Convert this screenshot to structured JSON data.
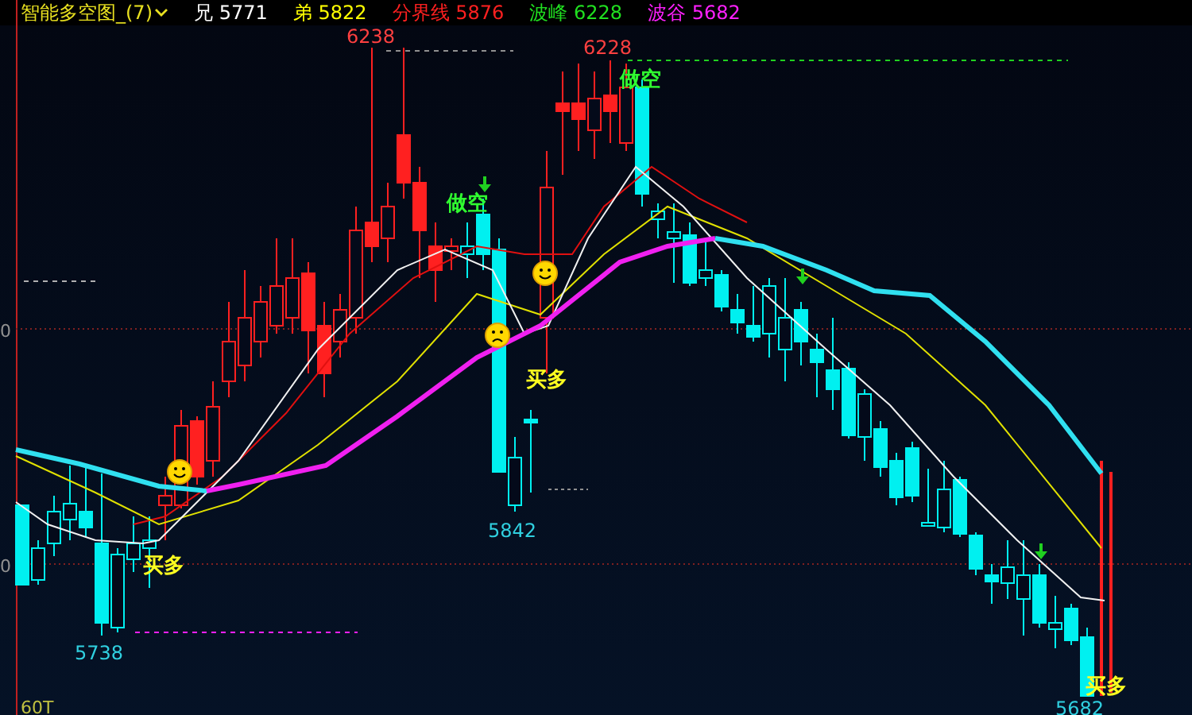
{
  "header": {
    "title": "智能多空图_(7)",
    "legend": [
      {
        "label": "兄",
        "value": "5771",
        "color": "#ffffff"
      },
      {
        "label": "弟",
        "value": "5822",
        "color": "#ffff00"
      },
      {
        "label": "分界线",
        "value": "5876",
        "color": "#ff2020"
      },
      {
        "label": "波峰",
        "value": "6228",
        "color": "#20e020"
      },
      {
        "label": "波谷",
        "value": "5682",
        "color": "#ff20ff"
      }
    ]
  },
  "axis_labels": [
    "0",
    "0",
    "60T"
  ],
  "price_labels": [
    "6238",
    "6228",
    "5842",
    "5738",
    "5682"
  ],
  "signals": [
    {
      "text": "做空",
      "kind": "sell"
    },
    {
      "text": "做空",
      "kind": "sell"
    },
    {
      "text": "买多",
      "kind": "buy"
    },
    {
      "text": "买多",
      "kind": "buy"
    },
    {
      "text": "买多",
      "kind": "buy"
    }
  ]
}
